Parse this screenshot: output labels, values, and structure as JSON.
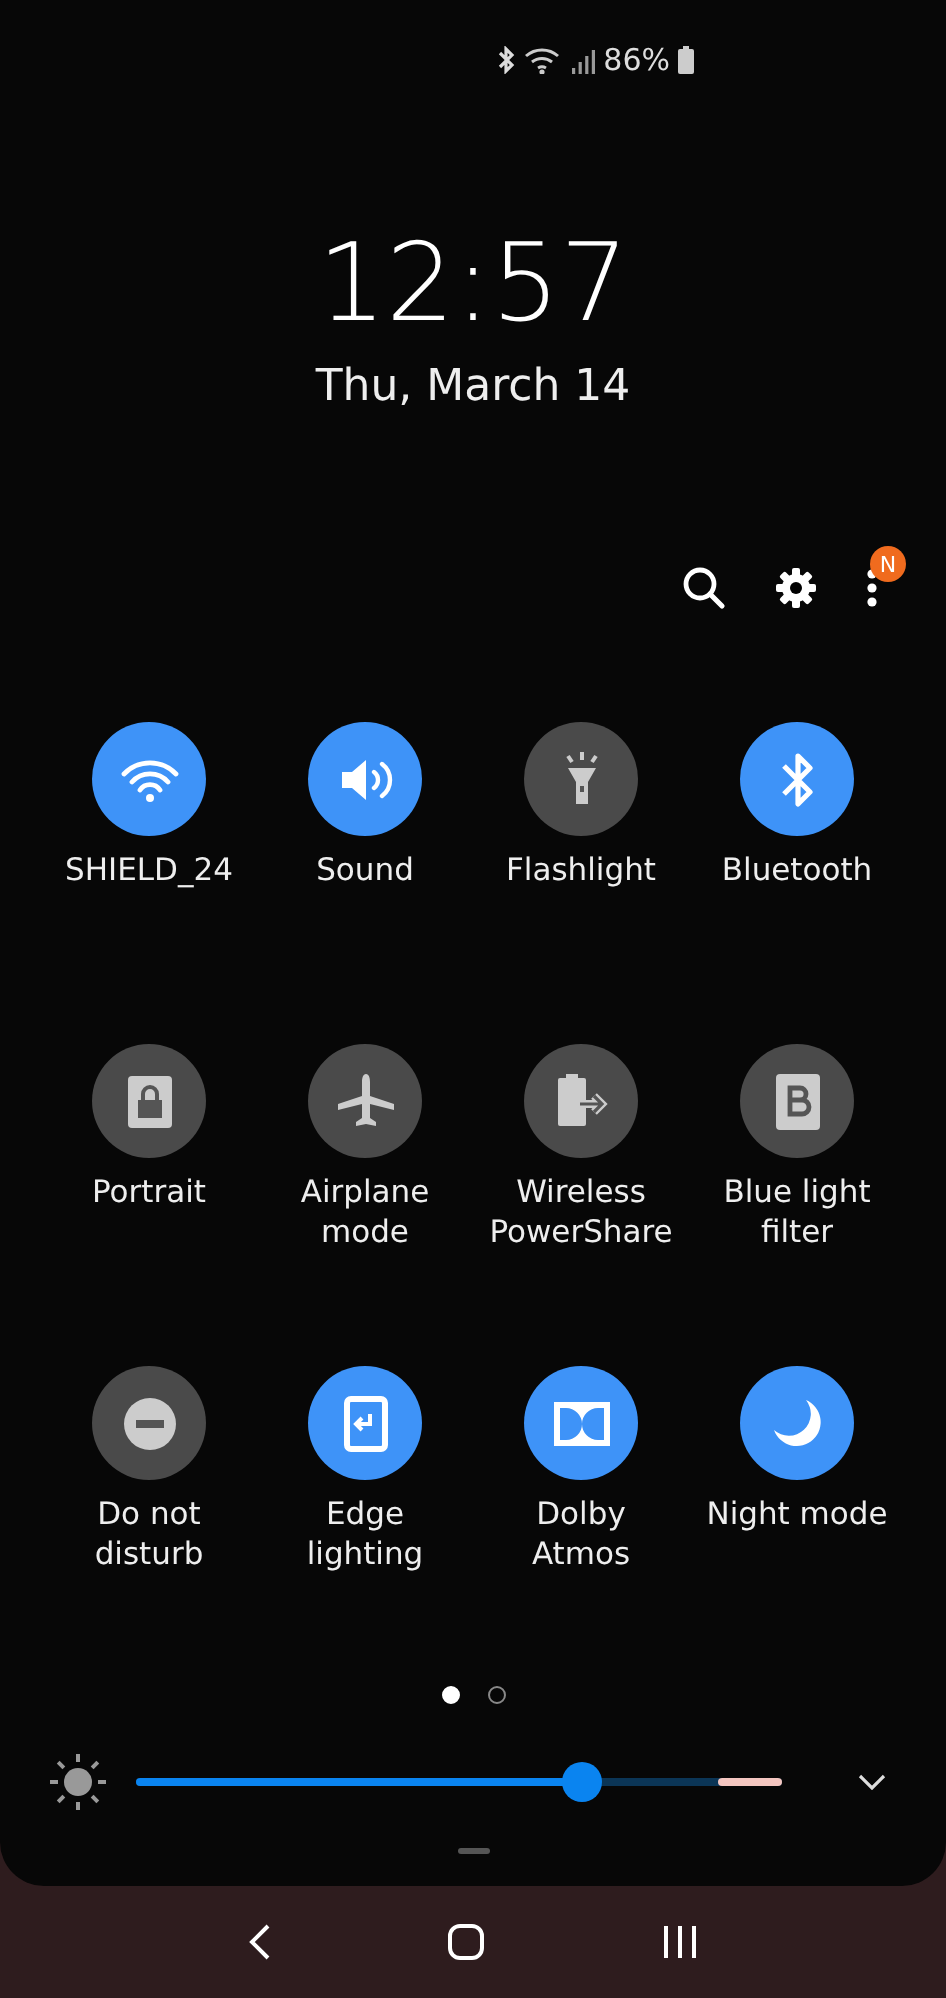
{
  "status_bar": {
    "battery": "86%"
  },
  "clock": {
    "time": "12:57",
    "date": "Thu, March 14"
  },
  "toolbar": {
    "notification_badge": "N"
  },
  "tiles": [
    {
      "kind": "wifi",
      "label": "SHIELD_24",
      "on": true
    },
    {
      "kind": "sound",
      "label": "Sound",
      "on": true
    },
    {
      "kind": "flashlight",
      "label": "Flashlight",
      "on": false
    },
    {
      "kind": "bluetooth",
      "label": "Bluetooth",
      "on": true
    },
    {
      "kind": "portrait",
      "label": "Portrait",
      "on": false
    },
    {
      "kind": "airplane",
      "label": "Airplane mode",
      "on": false
    },
    {
      "kind": "powershare",
      "label": "Wireless PowerShare",
      "on": false
    },
    {
      "kind": "bluelight",
      "label": "Blue light filter",
      "on": false
    },
    {
      "kind": "dnd",
      "label": "Do not disturb",
      "on": false
    },
    {
      "kind": "edge",
      "label": "Edge lighting",
      "on": true
    },
    {
      "kind": "dolby",
      "label": "Dolby Atmos",
      "on": true
    },
    {
      "kind": "night",
      "label": "Night mode",
      "on": true
    }
  ],
  "pages": [
    {
      "selected": true
    },
    {
      "selected": false
    }
  ],
  "brightness": {
    "level": 0.69
  }
}
